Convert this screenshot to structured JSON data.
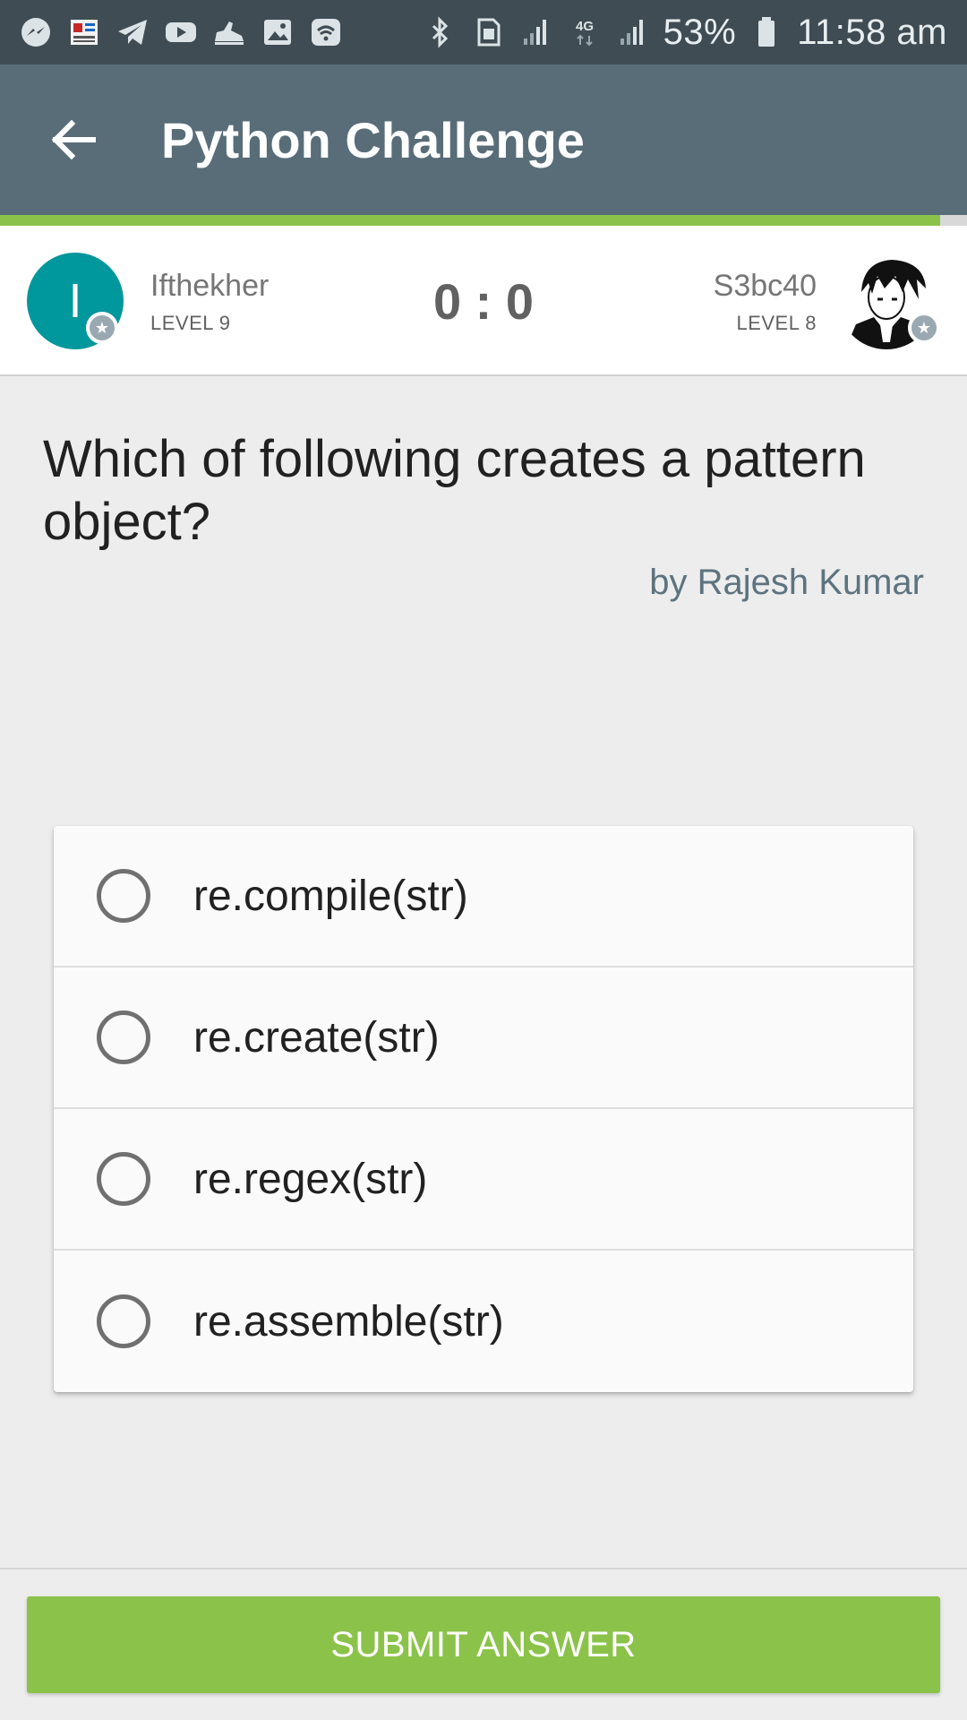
{
  "status_bar": {
    "icons_left": [
      "messenger-icon",
      "newspaper-icon",
      "telegram-icon",
      "youtube-icon",
      "sneaker-icon",
      "gallery-icon",
      "wifi-hotspot-icon"
    ],
    "icons_right": [
      "bluetooth-icon",
      "sim-icon",
      "signal-icon",
      "network-4g-icon",
      "signal-icon",
      "battery-icon"
    ],
    "battery": "53%",
    "time": "11:58 am"
  },
  "app_bar": {
    "title": "Python Challenge",
    "progress": 0.972,
    "colors": {
      "bar": "#586d78",
      "status": "#404c54",
      "progress": "#8bc34a"
    }
  },
  "players": {
    "left": {
      "initial": "I",
      "name": "Ifthekher",
      "level": "LEVEL 9",
      "avatar_color": "#00979d"
    },
    "right": {
      "name": "S3bc40",
      "level": "LEVEL 8"
    },
    "score": "0 : 0"
  },
  "question": {
    "text": "Which of following creates a pattern object?",
    "author": "by Rajesh Kumar"
  },
  "options": [
    {
      "label": "re.compile(str)",
      "selected": false
    },
    {
      "label": "re.create(str)",
      "selected": false
    },
    {
      "label": "re.regex(str)",
      "selected": false
    },
    {
      "label": "re.assemble(str)",
      "selected": false
    }
  ],
  "submit": {
    "label": "SUBMIT ANSWER",
    "color": "#8bc34a"
  }
}
